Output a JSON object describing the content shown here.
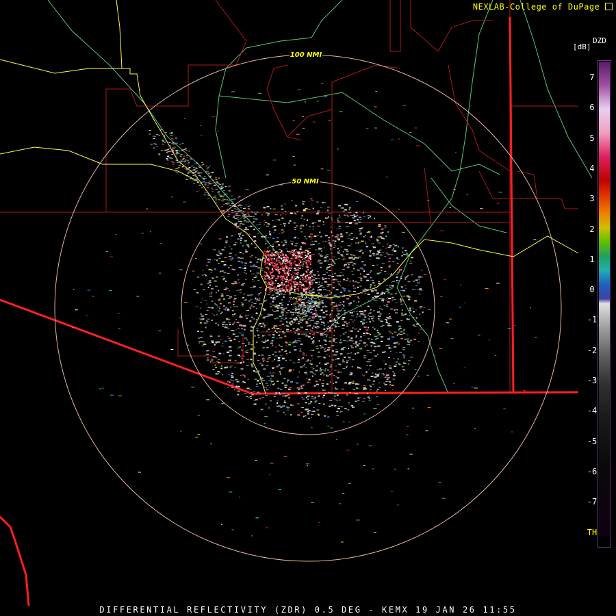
{
  "credit": "NEXLAB-College of DuPage",
  "credit_icon": "external-link-icon",
  "product_code": "DZD",
  "units": "[dB]",
  "footer": "DIFFERENTIAL REFLECTIVITY (ZDR) 0.5 DEG - KEMX 19 JAN 26 11:55",
  "range_rings": [
    {
      "label": "50 NMI"
    },
    {
      "label": "100 NMI"
    }
  ],
  "scale_ticks": [
    "7",
    "6",
    "5",
    "4",
    "3",
    "2",
    "1",
    "0",
    "-1",
    "-2",
    "-3",
    "-4",
    "-5",
    "-6",
    "-7",
    "TH"
  ],
  "colors": {
    "background": "#000000",
    "county_lines": "#b01818",
    "state_border": "#ff2020",
    "highways": "#ffff40",
    "rivers": "#58c878",
    "range_rings": "#e8b4a0",
    "label_text": "#ffff00"
  }
}
